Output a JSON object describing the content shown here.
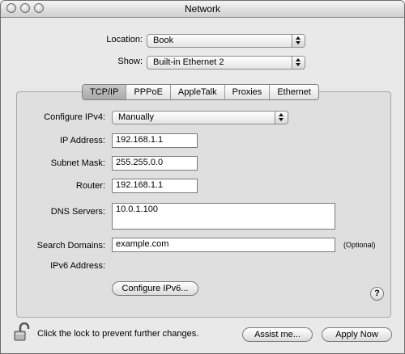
{
  "window": {
    "title": "Network"
  },
  "location": {
    "label": "Location:",
    "value": "Book"
  },
  "show": {
    "label": "Show:",
    "value": "Built-in Ethernet 2"
  },
  "tabs": [
    {
      "label": "TCP/IP",
      "selected": true
    },
    {
      "label": "PPPoE"
    },
    {
      "label": "AppleTalk"
    },
    {
      "label": "Proxies"
    },
    {
      "label": "Ethernet"
    }
  ],
  "tcpip": {
    "configure": {
      "label": "Configure IPv4:",
      "value": "Manually"
    },
    "ip": {
      "label": "IP Address:",
      "value": "192.168.1.1"
    },
    "subnet": {
      "label": "Subnet Mask:",
      "value": "255.255.0.0"
    },
    "router": {
      "label": "Router:",
      "value": "192.168.1.1"
    },
    "dns": {
      "label": "DNS Servers:",
      "value": "10.0.1.100"
    },
    "search": {
      "label": "Search Domains:",
      "value": "example.com",
      "note": "(Optional)"
    },
    "ipv6": {
      "label": "IPv6 Address:",
      "button": "Configure IPv6..."
    }
  },
  "help": "?",
  "footer": {
    "lock_text": "Click the lock to prevent further changes.",
    "assist": "Assist me...",
    "apply": "Apply Now"
  },
  "icons": [
    "close-icon",
    "minimize-icon",
    "zoom-icon",
    "popup-arrows-icon",
    "help-icon",
    "lock-icon"
  ]
}
